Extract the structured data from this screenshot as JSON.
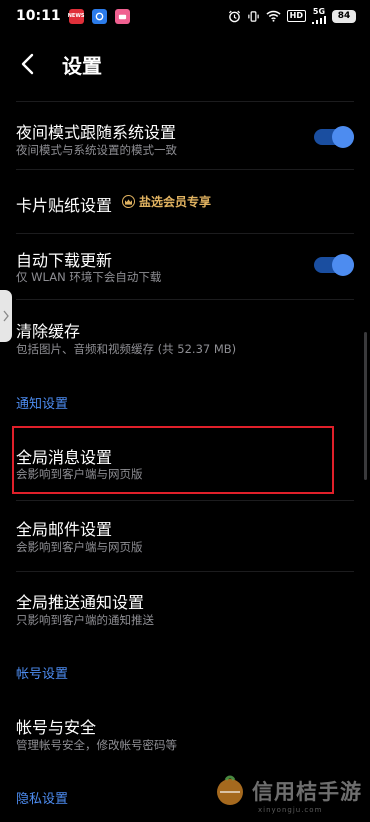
{
  "status_bar": {
    "time": "10:11",
    "apps": [
      {
        "icon": "news-app-icon",
        "color": "#e0303a",
        "label": "NEWS"
      },
      {
        "icon": "alipay-app-icon",
        "color": "#2b7bea",
        "label": ""
      },
      {
        "icon": "taobao-app-icon",
        "color": "#f06090",
        "label": ""
      }
    ],
    "hd": "HD",
    "signal_label": "5G",
    "battery": "84"
  },
  "header": {
    "title": "设置"
  },
  "rows": {
    "night_mode": {
      "title": "夜间模式跟随系统设置",
      "subtitle": "夜间模式与系统设置的模式一致",
      "toggle_on": true
    },
    "card_sticker": {
      "title": "卡片贴纸设置",
      "badge": "盐选会员专享"
    },
    "auto_update": {
      "title": "自动下载更新",
      "subtitle": "仅 WLAN 环境下会自动下载",
      "toggle_on": true
    },
    "clear_cache": {
      "title": "清除缓存",
      "subtitle": "包括图片、音频和视频缓存 (共 52.37 MB)"
    },
    "global_message": {
      "title": "全局消息设置",
      "subtitle": "会影响到客户端与网页版"
    },
    "global_mail": {
      "title": "全局邮件设置",
      "subtitle": "会影响到客户端与网页版"
    },
    "global_push": {
      "title": "全局推送通知设置",
      "subtitle": "只影响到客户端的通知推送"
    },
    "account_security": {
      "title": "帐号与安全",
      "subtitle": "管理帐号安全，修改帐号密码等"
    }
  },
  "sections": {
    "notification": "通知设置",
    "account": "帐号设置",
    "privacy": "隐私设置"
  },
  "watermark": {
    "text": "信用桔手游",
    "sub": "xinyongju.com"
  },
  "colors": {
    "accent": "#4d8cf0",
    "highlight": "#e0202a",
    "vip_gold": "#e0b260"
  }
}
